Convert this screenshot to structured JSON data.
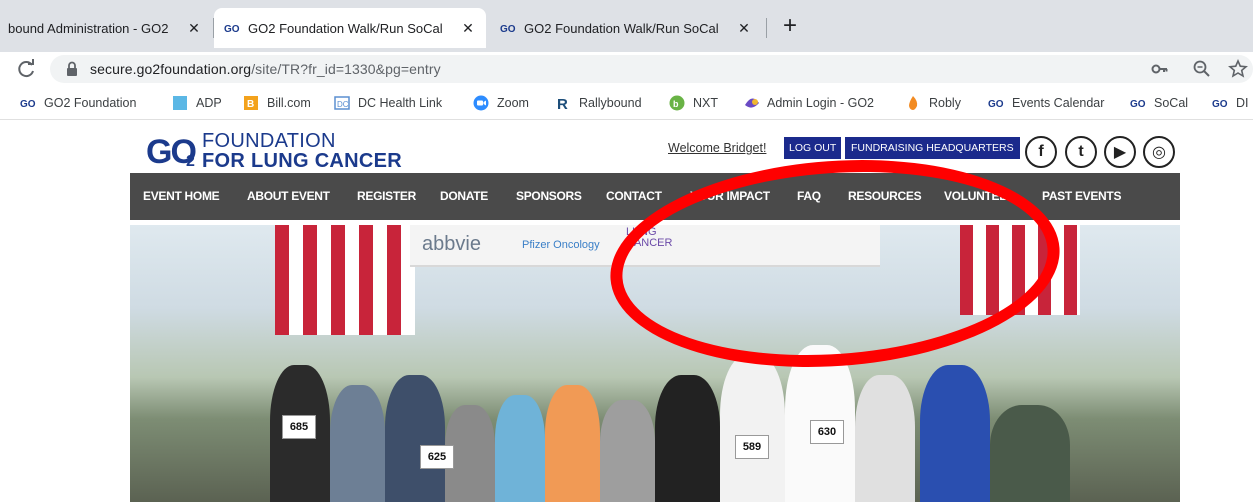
{
  "browser": {
    "tabs": [
      {
        "title": "bound Administration - GO2",
        "active": false
      },
      {
        "title": "GO2 Foundation Walk/Run SoCal",
        "active": true
      },
      {
        "title": "GO2 Foundation Walk/Run SoCal",
        "active": false
      }
    ],
    "new_tab_symbol": "+",
    "close_symbol": "✕",
    "url_host": "secure.go2foundation.org",
    "url_path": "/site/TR?fr_id=1330&pg=entry",
    "bookmarks": [
      {
        "label": "GO2 Foundation",
        "icon": "go2-icon"
      },
      {
        "label": "ADP",
        "icon": "adp-icon"
      },
      {
        "label": "Bill.com",
        "icon": "billcom-icon"
      },
      {
        "label": "DC Health Link",
        "icon": "dc-health-icon"
      },
      {
        "label": "Zoom",
        "icon": "zoom-icon"
      },
      {
        "label": "Rallybound",
        "icon": "rallybound-icon"
      },
      {
        "label": "NXT",
        "icon": "nxt-icon"
      },
      {
        "label": "Admin Login - GO2",
        "icon": "admin-icon"
      },
      {
        "label": "Robly",
        "icon": "robly-icon"
      },
      {
        "label": "Events Calendar",
        "icon": "go2-icon"
      },
      {
        "label": "SoCal",
        "icon": "go2-icon"
      },
      {
        "label": "DI",
        "icon": "go2-icon"
      }
    ]
  },
  "site": {
    "logo": {
      "go": "GO",
      "two": "2",
      "line1": "FOUNDATION",
      "line2": "FOR LUNG CANCER"
    },
    "welcome": "Welcome Bridget!",
    "logout": "LOG OUT",
    "fundraising_hq": "FUNDRAISING HEADQUARTERS",
    "social": [
      {
        "name": "facebook-icon",
        "glyph": "f"
      },
      {
        "name": "twitter-icon",
        "glyph": "t"
      },
      {
        "name": "youtube-icon",
        "glyph": "▶"
      },
      {
        "name": "instagram-icon",
        "glyph": "◎"
      }
    ],
    "nav": [
      "EVENT HOME",
      "ABOUT EVENT",
      "REGISTER",
      "DONATE",
      "SPONSORS",
      "CONTACT",
      "YOUR IMPACT",
      "FAQ",
      "RESOURCES",
      "VOLUNTEER",
      "PAST EVENTS"
    ],
    "hero": {
      "sponsors": [
        "abbvie",
        "Pfizer Oncology",
        "LUNG CANCER"
      ],
      "bibs": [
        "685",
        "625",
        "589",
        "630"
      ]
    }
  },
  "colors": {
    "brand": "#1b3a8c",
    "button": "#1b2a8c",
    "nav": "#4a4a4a",
    "annotation": "#ff0000"
  }
}
